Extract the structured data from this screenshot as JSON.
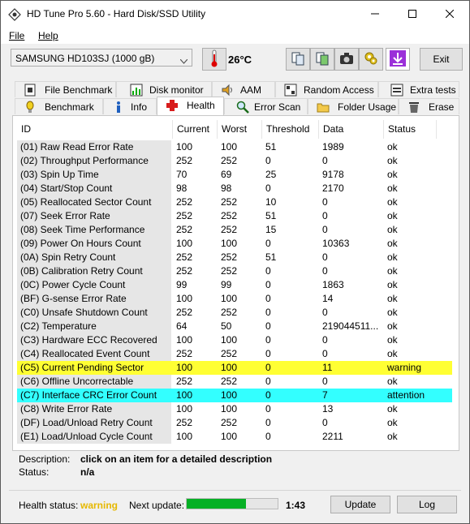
{
  "window": {
    "title": "HD Tune Pro 5.60 - Hard Disk/SSD Utility",
    "minimize_icon": "minimize-icon",
    "maximize_icon": "maximize-icon",
    "close_icon": "close-icon"
  },
  "menu": {
    "file": "File",
    "help": "Help"
  },
  "toolbar": {
    "drive": "SAMSUNG HD103SJ (1000 gB)",
    "temperature": "26°C",
    "exit_label": "Exit"
  },
  "tabs_top": [
    {
      "label": "File Benchmark",
      "icon": "file-benchmark-icon"
    },
    {
      "label": "Disk monitor",
      "icon": "disk-monitor-icon"
    },
    {
      "label": "AAM",
      "icon": "speaker-icon"
    },
    {
      "label": "Random Access",
      "icon": "random-access-icon"
    },
    {
      "label": "Extra tests",
      "icon": "extra-tests-icon"
    }
  ],
  "tabs_bottom": [
    {
      "label": "Benchmark",
      "icon": "benchmark-icon"
    },
    {
      "label": "Info",
      "icon": "info-icon"
    },
    {
      "label": "Health",
      "icon": "health-icon"
    },
    {
      "label": "Error Scan",
      "icon": "error-scan-icon"
    },
    {
      "label": "Folder Usage",
      "icon": "folder-icon"
    },
    {
      "label": "Erase",
      "icon": "erase-icon"
    }
  ],
  "table": {
    "headers": [
      "ID",
      "Current",
      "Worst",
      "Threshold",
      "Data",
      "Status"
    ],
    "rows": [
      [
        "(01) Raw Read Error Rate",
        "100",
        "100",
        "51",
        "1989",
        "ok"
      ],
      [
        "(02) Throughput Performance",
        "252",
        "252",
        "0",
        "0",
        "ok"
      ],
      [
        "(03) Spin Up Time",
        "70",
        "69",
        "25",
        "9178",
        "ok"
      ],
      [
        "(04) Start/Stop Count",
        "98",
        "98",
        "0",
        "2170",
        "ok"
      ],
      [
        "(05) Reallocated Sector Count",
        "252",
        "252",
        "10",
        "0",
        "ok"
      ],
      [
        "(07) Seek Error Rate",
        "252",
        "252",
        "51",
        "0",
        "ok"
      ],
      [
        "(08) Seek Time Performance",
        "252",
        "252",
        "15",
        "0",
        "ok"
      ],
      [
        "(09) Power On Hours Count",
        "100",
        "100",
        "0",
        "10363",
        "ok"
      ],
      [
        "(0A) Spin Retry Count",
        "252",
        "252",
        "51",
        "0",
        "ok"
      ],
      [
        "(0B) Calibration Retry Count",
        "252",
        "252",
        "0",
        "0",
        "ok"
      ],
      [
        "(0C) Power Cycle Count",
        "99",
        "99",
        "0",
        "1863",
        "ok"
      ],
      [
        "(BF) G-sense Error Rate",
        "100",
        "100",
        "0",
        "14",
        "ok"
      ],
      [
        "(C0) Unsafe Shutdown Count",
        "252",
        "252",
        "0",
        "0",
        "ok"
      ],
      [
        "(C2) Temperature",
        "64",
        "50",
        "0",
        "219044511...",
        "ok"
      ],
      [
        "(C3) Hardware ECC Recovered",
        "100",
        "100",
        "0",
        "0",
        "ok"
      ],
      [
        "(C4) Reallocated Event Count",
        "252",
        "252",
        "0",
        "0",
        "ok"
      ],
      [
        "(C5) Current Pending Sector",
        "100",
        "100",
        "0",
        "11",
        "warning"
      ],
      [
        "(C6) Offline Uncorrectable",
        "252",
        "252",
        "0",
        "0",
        "ok"
      ],
      [
        "(C7) Interface CRC Error Count",
        "100",
        "100",
        "0",
        "7",
        "attention"
      ],
      [
        "(C8) Write Error Rate",
        "100",
        "100",
        "0",
        "13",
        "ok"
      ],
      [
        "(DF) Load/Unload Retry Count",
        "252",
        "252",
        "0",
        "0",
        "ok"
      ],
      [
        "(E1) Load/Unload Cycle Count",
        "100",
        "100",
        "0",
        "2211",
        "ok"
      ]
    ],
    "highlight_colors": {
      "warning": "#ffff33",
      "attention": "#33ffff"
    }
  },
  "description": {
    "desc_label": "Description:",
    "desc_value": "click on an item for a detailed description",
    "status_label": "Status:",
    "status_value": "n/a"
  },
  "statusbar": {
    "health_label": "Health status:",
    "health_value": "warning",
    "health_color": "#e6b800",
    "next_update_label": "Next update:",
    "progress_fraction": 0.65,
    "countdown": "1:43",
    "update_label": "Update",
    "log_label": "Log"
  }
}
